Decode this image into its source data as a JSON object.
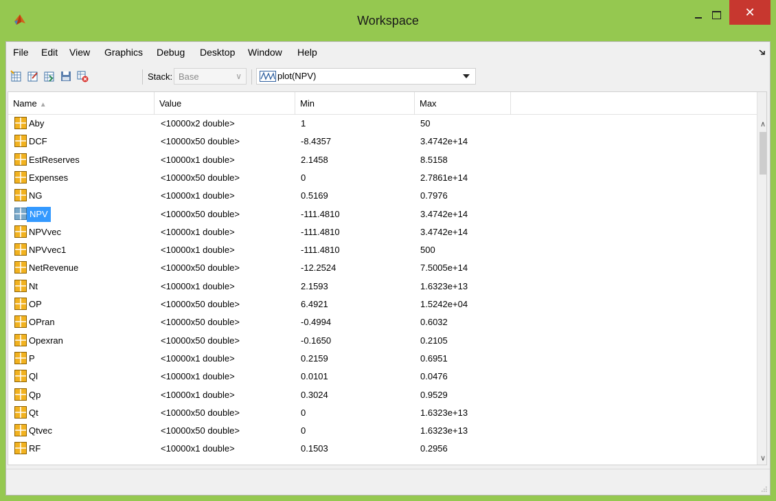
{
  "window": {
    "title": "Workspace",
    "close_glyph": "✕",
    "accent_color": "#95c850",
    "close_color": "#c7372f"
  },
  "icons": {
    "app": "matlab-logo-icon",
    "minimize": "minimize-icon",
    "maximize": "maximize-icon",
    "close": "close-icon",
    "menu_overflow": "dock-arrow-icon",
    "variable": "matrix-variable-icon"
  },
  "menu": {
    "items": [
      "File",
      "Edit",
      "View",
      "Graphics",
      "Debug",
      "Desktop",
      "Window",
      "Help"
    ]
  },
  "toolbar": {
    "buttons": [
      "new-variable-icon",
      "open-selection-icon",
      "import-data-icon",
      "save-workspace-icon",
      "delete-variable-icon"
    ],
    "stack_label": "Stack:",
    "stack_value": "Base",
    "stack_chevron": "∨",
    "plot_value": "plot(NPV)"
  },
  "table": {
    "columns": [
      "Name",
      "Value",
      "Min",
      "Max"
    ],
    "sort_indicator": "▲",
    "selected_row": "NPV",
    "rows": [
      {
        "name": "Aby",
        "value": "<10000x2 double>",
        "min": "1",
        "max": "50"
      },
      {
        "name": "DCF",
        "value": "<10000x50 double>",
        "min": "-8.4357",
        "max": "3.4742e+14"
      },
      {
        "name": "EstReserves",
        "value": "<10000x1 double>",
        "min": "2.1458",
        "max": "8.5158"
      },
      {
        "name": "Expenses",
        "value": "<10000x50 double>",
        "min": "0",
        "max": "2.7861e+14"
      },
      {
        "name": "NG",
        "value": "<10000x1 double>",
        "min": "0.5169",
        "max": "0.7976"
      },
      {
        "name": "NPV",
        "value": "<10000x50 double>",
        "min": "-111.4810",
        "max": "3.4742e+14"
      },
      {
        "name": "NPVvec",
        "value": "<10000x1 double>",
        "min": "-111.4810",
        "max": "3.4742e+14"
      },
      {
        "name": "NPVvec1",
        "value": "<10000x1 double>",
        "min": "-111.4810",
        "max": "500"
      },
      {
        "name": "NetRevenue",
        "value": "<10000x50 double>",
        "min": "-12.2524",
        "max": "7.5005e+14"
      },
      {
        "name": "Nt",
        "value": "<10000x1 double>",
        "min": "2.1593",
        "max": "1.6323e+13"
      },
      {
        "name": "OP",
        "value": "<10000x50 double>",
        "min": "6.4921",
        "max": "1.5242e+04"
      },
      {
        "name": "OPran",
        "value": "<10000x50 double>",
        "min": "-0.4994",
        "max": "0.6032"
      },
      {
        "name": "Opexran",
        "value": "<10000x50 double>",
        "min": "-0.1650",
        "max": "0.2105"
      },
      {
        "name": "P",
        "value": "<10000x1 double>",
        "min": "0.2159",
        "max": "0.6951"
      },
      {
        "name": "Ql",
        "value": "<10000x1 double>",
        "min": "0.0101",
        "max": "0.0476"
      },
      {
        "name": "Qp",
        "value": "<10000x1 double>",
        "min": "0.3024",
        "max": "0.9529"
      },
      {
        "name": "Qt",
        "value": "<10000x50 double>",
        "min": "0",
        "max": "1.6323e+13"
      },
      {
        "name": "Qtvec",
        "value": "<10000x50 double>",
        "min": "0",
        "max": "1.6323e+13"
      },
      {
        "name": "RF",
        "value": "<10000x1 double>",
        "min": "0.1503",
        "max": "0.2956"
      }
    ]
  },
  "scrollbar": {
    "up_glyph": "∧",
    "down_glyph": "∨"
  }
}
